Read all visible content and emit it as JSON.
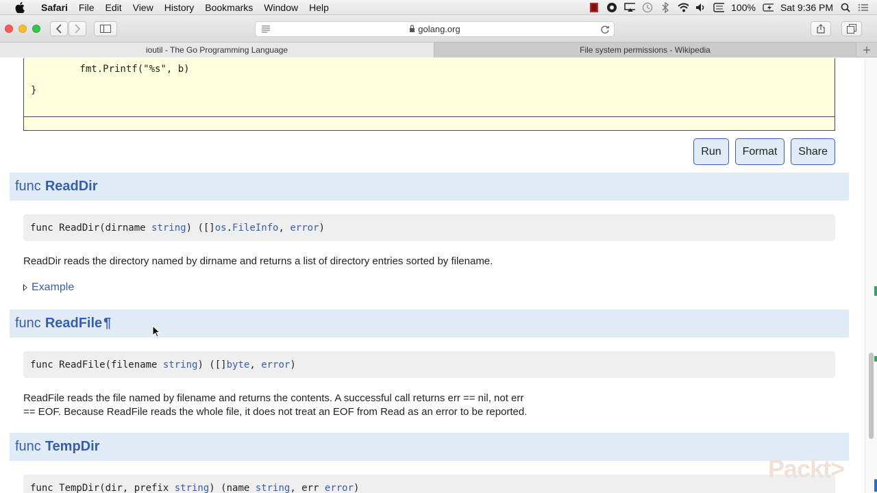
{
  "menubar": {
    "app": "Safari",
    "items": [
      "File",
      "Edit",
      "View",
      "History",
      "Bookmarks",
      "Window",
      "Help"
    ],
    "battery": "100%",
    "clock": "Sat 9:36 PM"
  },
  "browser": {
    "url": "golang.org",
    "tabs": [
      {
        "title": "ioutil - The Go Programming Language",
        "active": true
      },
      {
        "title": "File system permissions - Wikipedia",
        "active": false
      }
    ]
  },
  "code": {
    "line1": "        fmt.Printf(\"%s\", b)",
    "line2": "}"
  },
  "buttons": {
    "run": "Run",
    "format": "Format",
    "share": "Share"
  },
  "sections": {
    "readdir": {
      "keyword": "func",
      "name": "ReadDir",
      "sig": {
        "p1": "func ReadDir(dirname ",
        "t1": "string",
        "p2": ") ([]",
        "t2": "os",
        "p3": ".",
        "t3": "FileInfo",
        "p4": ", ",
        "t4": "error",
        "p5": ")"
      },
      "desc": "ReadDir reads the directory named by dirname and returns a list of directory entries sorted by filename.",
      "example": "Example"
    },
    "readfile": {
      "keyword": "func",
      "name": "ReadFile",
      "pilcrow": "¶",
      "sig": {
        "p1": "func ReadFile(filename ",
        "t1": "string",
        "p2": ") ([]",
        "t2": "byte",
        "p3": ", ",
        "t3": "error",
        "p4": ")"
      },
      "desc1": "ReadFile reads the file named by filename and returns the contents. A successful call returns err == nil, not err",
      "desc2": "== EOF. Because ReadFile reads the whole file, it does not treat an EOF from Read as an error to be reported."
    },
    "tempdir": {
      "keyword": "func",
      "name": "TempDir",
      "sig": {
        "p1": "func TempDir(dir, prefix ",
        "t1": "string",
        "p2": ") (name ",
        "t2": "string",
        "p3": ", err ",
        "t3": "error",
        "p4": ")"
      }
    }
  },
  "watermark": "Packt>",
  "colors": {
    "link": "#375eab",
    "header_bg": "#e0ebf5",
    "code_bg": "#ffffdd",
    "sig_bg": "#efefef"
  }
}
